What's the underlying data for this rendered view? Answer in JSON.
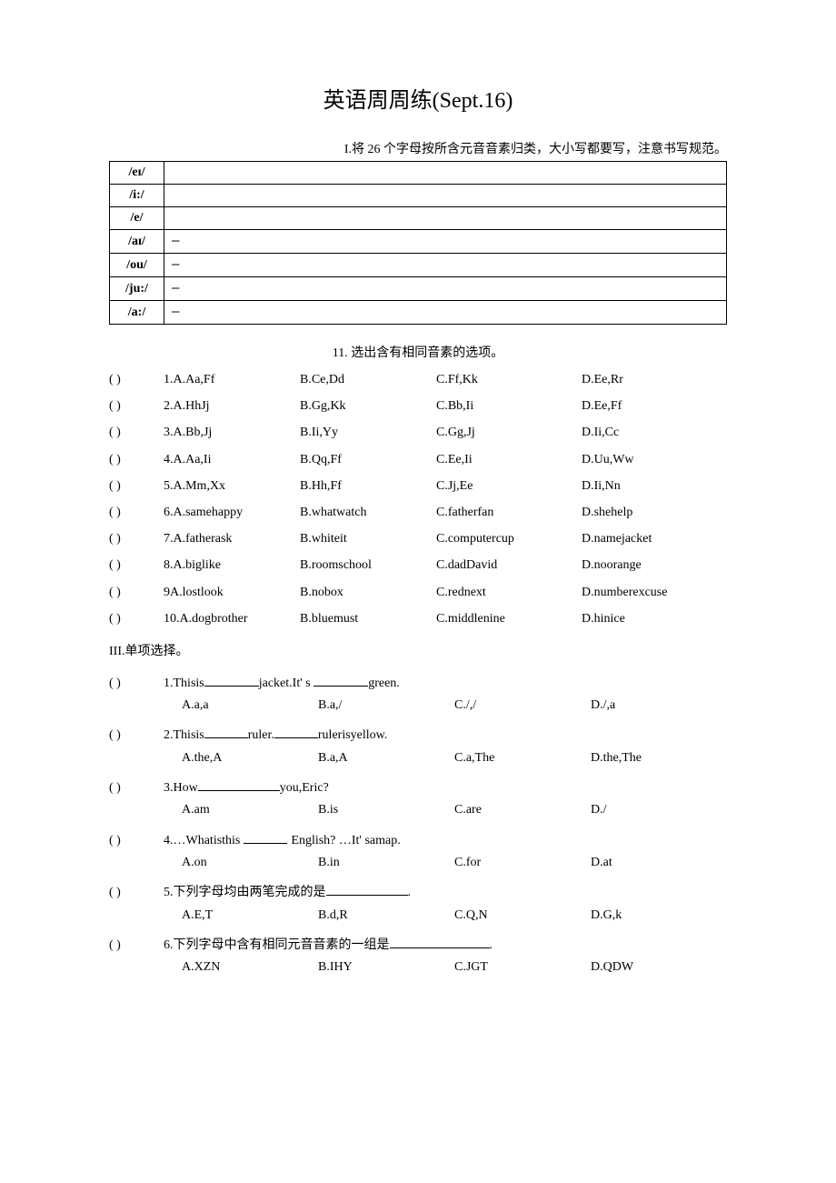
{
  "title": "英语周周练(Sept.16)",
  "section1": {
    "instruction": "I.将 26 个字母按所含元音音素归类，大小写都要写，注意书写规范。",
    "rows": [
      {
        "label": "/eɪ/",
        "dash": ""
      },
      {
        "label": "/i:/",
        "dash": ""
      },
      {
        "label": "/e/",
        "dash": ""
      },
      {
        "label": "/aɪ/",
        "dash": "—"
      },
      {
        "label": "/ou/",
        "dash": "—"
      },
      {
        "label": "/ju:/",
        "dash": "—"
      },
      {
        "label": "/a:/",
        "dash": "—"
      }
    ]
  },
  "section2": {
    "title": "11. 选出含有相同音素的选项。",
    "paren": "(       )",
    "questions": [
      {
        "num": "1.",
        "a": "A.Aa,Ff",
        "b": "B.Ce,Dd",
        "c": "C.Ff,Kk",
        "d": "D.Ee,Rr"
      },
      {
        "num": "2.",
        "a": "A.HhJj",
        "b": "B.Gg,Kk",
        "c": "C.Bb,Ii",
        "d": "D.Ee,Ff"
      },
      {
        "num": "3.",
        "a": "A.Bb,Jj",
        "b": "B.Ii,Yy",
        "c": "C.Gg,Jj",
        "d": "D.Ii,Cc"
      },
      {
        "num": "4.",
        "a": "A.Aa,Ii",
        "b": "B.Qq,Ff",
        "c": "C.Ee,Ii",
        "d": "D.Uu,Ww"
      },
      {
        "num": "5.",
        "a": "A.Mm,Xx",
        "b": "B.Hh,Ff",
        "c": "C.Jj,Ee",
        "d": "D.Ii,Nn"
      },
      {
        "num": "6.",
        "a": "A.samehappy",
        "b": "B.whatwatch",
        "c": "C.fatherfan",
        "d": "D.shehelp"
      },
      {
        "num": "7.",
        "a": "A.fatherask",
        "b": "B.whiteit",
        "c": "C.computercup",
        "d": "D.namejacket"
      },
      {
        "num": "8.",
        "a": "A.biglike",
        "b": "B.roomschool",
        "c": "C.dadDavid",
        "d": "D.noorange"
      },
      {
        "num": "9",
        "a": "A.lostlook",
        "b": "B.nobox",
        "c": "C.rednext",
        "d": "D.numberexcuse"
      },
      {
        "num": "10.",
        "a": "A.dogbrother",
        "b": "B.bluemust",
        "c": "C.middlenine",
        "d": "D.hinice"
      }
    ]
  },
  "section3": {
    "title": "III.单项选择。",
    "paren": "(       )",
    "questions": [
      {
        "num": "1.",
        "stem_before": "Thisis",
        "stem_mid": "jacket.It' s ",
        "stem_after": "green.",
        "opts": [
          "A.a,a",
          "B.a,/",
          "C./,/",
          "D./,a"
        ]
      },
      {
        "num": "2.",
        "stem_before": "Thisis",
        "stem_mid": "ruler.",
        "stem_after": "rulerisyellow.",
        "opts": [
          "A.the,A",
          "B.a,A",
          "C.a,The",
          "D.the,The"
        ]
      },
      {
        "num": "3.",
        "stem_before": "How",
        "stem_mid": "",
        "stem_after": "you,Eric?",
        "opts": [
          "A.am",
          "B.is",
          "C.are",
          "D./"
        ]
      },
      {
        "num": "4.",
        "stem_before": "…Whatisthis",
        "stem_mid": "",
        "stem_after": "English?           …It' samap.",
        "opts": [
          "A.on",
          "B.in",
          "C.for",
          "D.at"
        ]
      },
      {
        "num": "5.",
        "stem_before": "下列字母均由两笔完成的是",
        "stem_mid": "",
        "stem_after": ".",
        "opts": [
          "A.E,T",
          "B.d,R",
          "C.Q,N",
          "D.G,k"
        ]
      },
      {
        "num": "6.",
        "stem_before": "下列字母中含有相同元音音素的一组是",
        "stem_mid": "",
        "stem_after": ".",
        "opts": [
          "A.XZN",
          "B.IHY",
          "C.JGT",
          "D.QDW"
        ]
      }
    ]
  }
}
